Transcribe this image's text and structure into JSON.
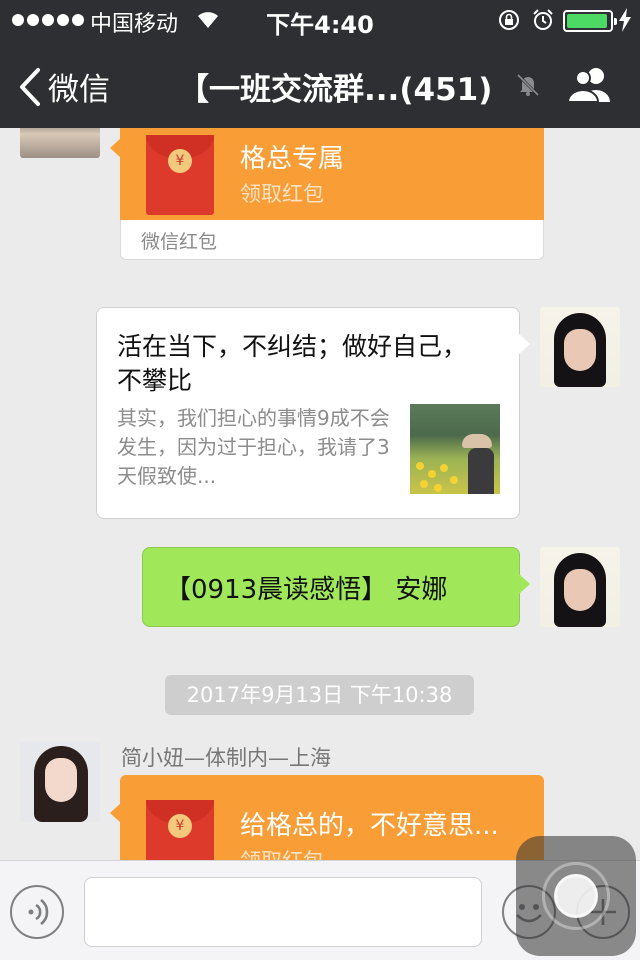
{
  "status_bar": {
    "carrier": "中国移动",
    "time": "下午4:40",
    "battery_level": 0.95,
    "battery_color": "#4cd964"
  },
  "nav": {
    "back_label": "微信",
    "title": "【一班交流群...(451)",
    "mute_icon": "mute-bell-icon",
    "members_icon": "group-members-icon"
  },
  "messages": [
    {
      "type": "red_packet",
      "direction": "incoming",
      "title": "格总专属",
      "subtitle": "领取红包",
      "footer": "微信红包"
    },
    {
      "type": "link_card",
      "direction": "outgoing",
      "title": "活在当下，不纠结；做好自己，不攀比",
      "description": "其实，我们担心的事情9成不会发生，因为过于担心，我请了3天假致使..."
    },
    {
      "type": "text",
      "direction": "outgoing",
      "text": "【0913晨读感悟】 安娜"
    },
    {
      "type": "timestamp",
      "text": "2017年9月13日 下午10:38"
    },
    {
      "type": "red_packet",
      "direction": "incoming",
      "sender": "简小妞—体制内—上海",
      "title": "给格总的，不好意思...",
      "subtitle": "领取红包"
    }
  ],
  "input_bar": {
    "voice_icon": "voice-icon",
    "emoji_icon": "emoji-icon",
    "plus_icon": "plus-icon",
    "text_value": ""
  },
  "colors": {
    "nav_bg": "#2e2f33",
    "chat_bg": "#ebebeb",
    "red_packet": "#f99d37",
    "outgoing_bubble": "#a0e75a"
  }
}
